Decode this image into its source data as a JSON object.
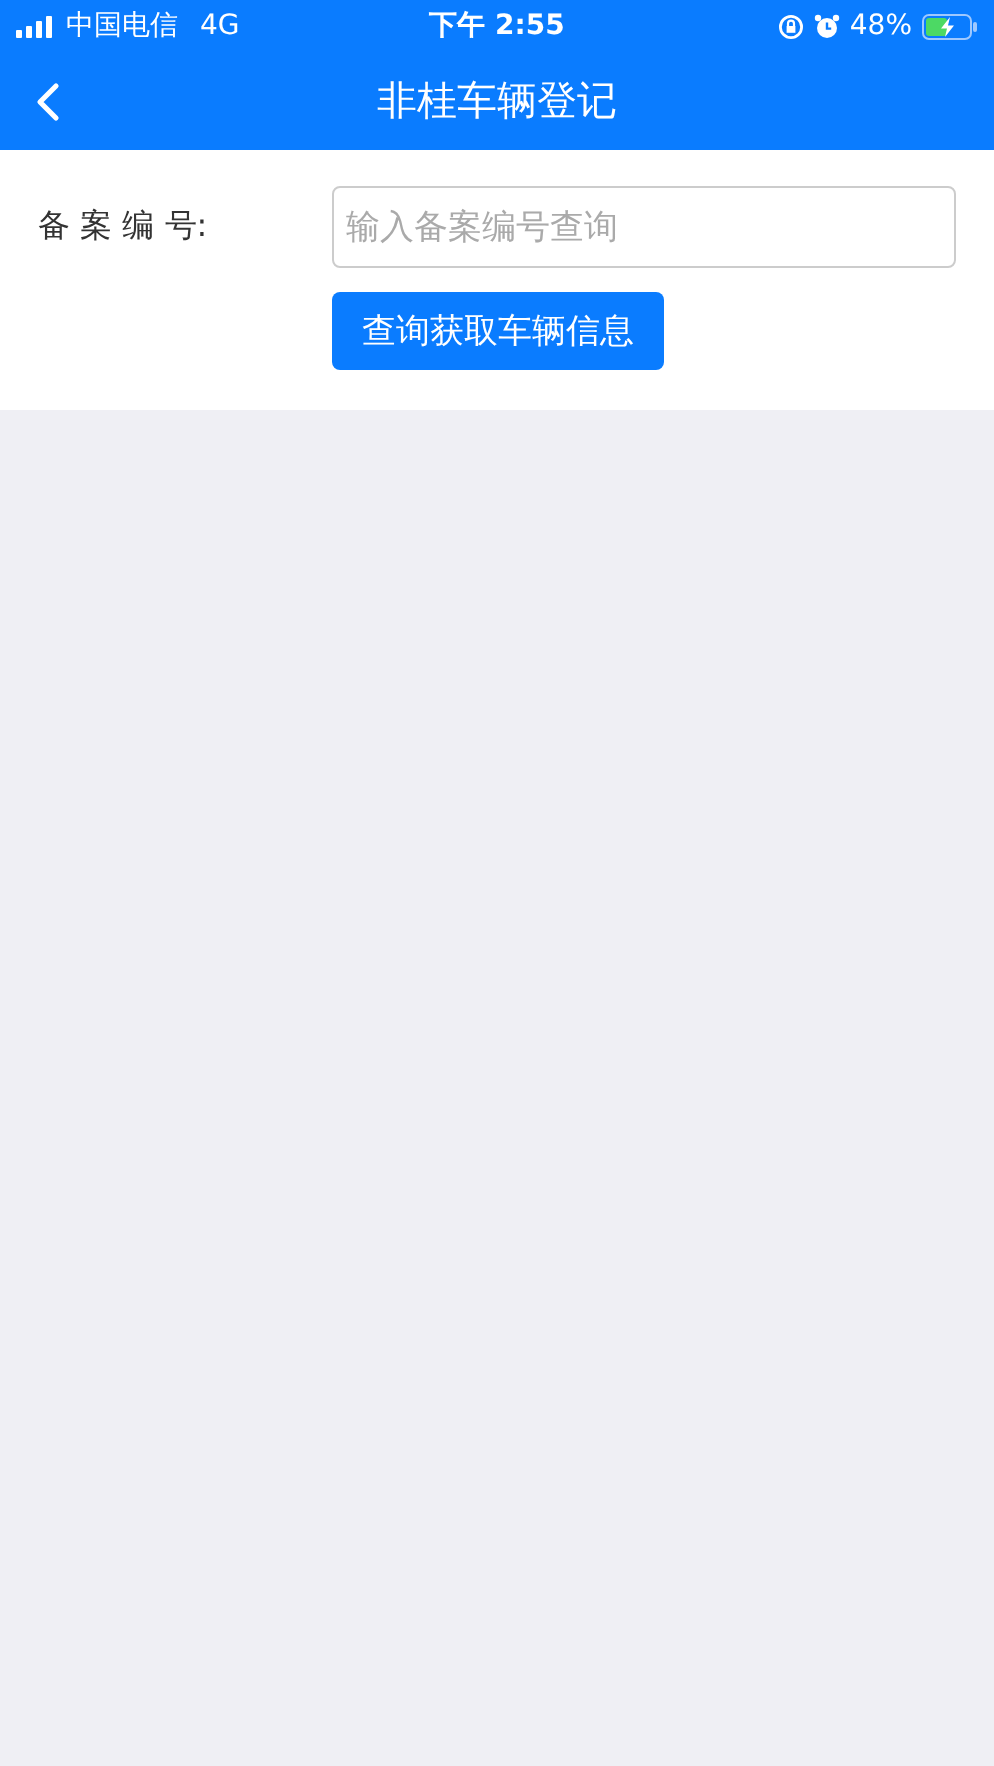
{
  "status_bar": {
    "carrier": "中国电信",
    "network": "4G",
    "time": "下午 2:55",
    "battery": "48%"
  },
  "nav": {
    "title": "非桂车辆登记"
  },
  "form": {
    "label": "备 案 编 号:",
    "placeholder": "输入备案编号查询",
    "button": "查询获取车辆信息"
  }
}
